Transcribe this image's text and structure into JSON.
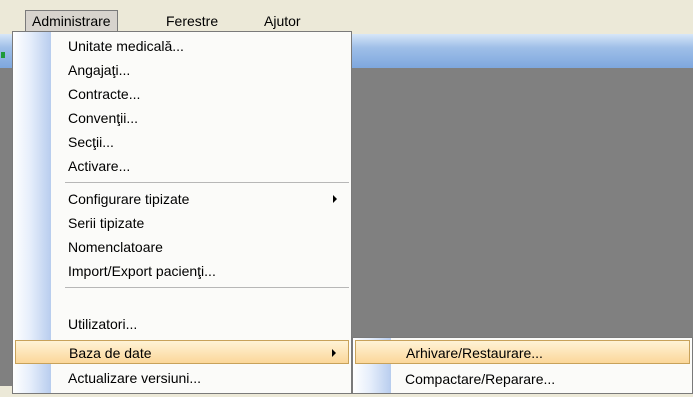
{
  "menubar": {
    "items": [
      {
        "label": "Administrare"
      },
      {
        "label": "Ferestre"
      },
      {
        "label": "Ajutor"
      }
    ]
  },
  "administrare_menu": {
    "items": [
      {
        "label": "Unitate medicală..."
      },
      {
        "label": "Angajaţi..."
      },
      {
        "label": "Contracte..."
      },
      {
        "label": "Convenţii..."
      },
      {
        "label": "Secţii..."
      },
      {
        "label": "Activare..."
      },
      {
        "label": "Configurare tipizate"
      },
      {
        "label": "Serii tipizate"
      },
      {
        "label": "Nomenclatoare"
      },
      {
        "label": "Import/Export pacienţi..."
      },
      {
        "label": "Utilizatori..."
      },
      {
        "label": "Baza de date"
      },
      {
        "label": "Actualizare versiuni..."
      }
    ]
  },
  "baza_de_date_submenu": {
    "items": [
      {
        "label": "Arhivare/Restaurare..."
      },
      {
        "label": "Compactare/Reparare..."
      }
    ]
  },
  "colors": {
    "workspace": "#808080",
    "highlight": "#fbd79a",
    "titlebar": "#9fbfe8"
  }
}
